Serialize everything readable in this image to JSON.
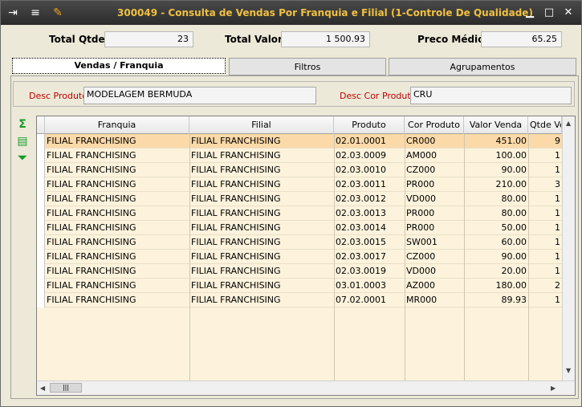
{
  "window": {
    "title": "300049 - Consulta de Vendas Por Franquia e Filial (1-Controle De Qualidade)",
    "icons": [
      "export-icon",
      "traffic-light-icon",
      "wrench-icon"
    ],
    "controls": [
      "minimize-icon",
      "maximize-icon",
      "close-icon"
    ]
  },
  "summary": {
    "total_qtde_label": "Total Qtde",
    "total_qtde_value": "23",
    "total_valor_label": "Total Valor",
    "total_valor_value": "1 500.93",
    "preco_medio_label": "Preco Médio",
    "preco_medio_value": "65.25"
  },
  "tabs": [
    {
      "label": "Vendas / Franquia",
      "active": true
    },
    {
      "label": "Filtros",
      "active": false
    },
    {
      "label": "Agrupamentos",
      "active": false
    }
  ],
  "filters": {
    "desc_produto_label": "Desc Produto",
    "desc_produto_value": "MODELAGEM BERMUDA",
    "desc_cor_label": "Desc Cor Produto",
    "desc_cor_value": "CRU"
  },
  "tools": [
    "sum-icon",
    "export-grid-icon",
    "expand-down-icon"
  ],
  "grid": {
    "columns": [
      "Franquia",
      "Filial",
      "Produto",
      "Cor Produto",
      "Valor Venda",
      "Qtde Ven"
    ],
    "rows": [
      [
        "FILIAL FRANCHISING",
        "FILIAL FRANCHISING",
        "02.01.0001",
        "CR000",
        "451.00",
        "9"
      ],
      [
        "FILIAL FRANCHISING",
        "FILIAL FRANCHISING",
        "02.03.0009",
        "AM000",
        "100.00",
        "1"
      ],
      [
        "FILIAL FRANCHISING",
        "FILIAL FRANCHISING",
        "02.03.0010",
        "CZ000",
        "90.00",
        "1"
      ],
      [
        "FILIAL FRANCHISING",
        "FILIAL FRANCHISING",
        "02.03.0011",
        "PR000",
        "210.00",
        "3"
      ],
      [
        "FILIAL FRANCHISING",
        "FILIAL FRANCHISING",
        "02.03.0012",
        "VD000",
        "80.00",
        "1"
      ],
      [
        "FILIAL FRANCHISING",
        "FILIAL FRANCHISING",
        "02.03.0013",
        "PR000",
        "80.00",
        "1"
      ],
      [
        "FILIAL FRANCHISING",
        "FILIAL FRANCHISING",
        "02.03.0014",
        "PR000",
        "50.00",
        "1"
      ],
      [
        "FILIAL FRANCHISING",
        "FILIAL FRANCHISING",
        "02.03.0015",
        "SW001",
        "60.00",
        "1"
      ],
      [
        "FILIAL FRANCHISING",
        "FILIAL FRANCHISING",
        "02.03.0017",
        "CZ000",
        "90.00",
        "1"
      ],
      [
        "FILIAL FRANCHISING",
        "FILIAL FRANCHISING",
        "02.03.0019",
        "VD000",
        "20.00",
        "1"
      ],
      [
        "FILIAL FRANCHISING",
        "FILIAL FRANCHISING",
        "03.01.0003",
        "AZ000",
        "180.00",
        "2"
      ],
      [
        "FILIAL FRANCHISING",
        "FILIAL FRANCHISING",
        "07.02.0001",
        "MR000",
        "89.93",
        "1"
      ]
    ]
  },
  "colors": {
    "title_text": "#f0c040",
    "label_red": "#c00000",
    "row_bg": "#fdf3dc",
    "row_selected": "#fbd9a8"
  }
}
